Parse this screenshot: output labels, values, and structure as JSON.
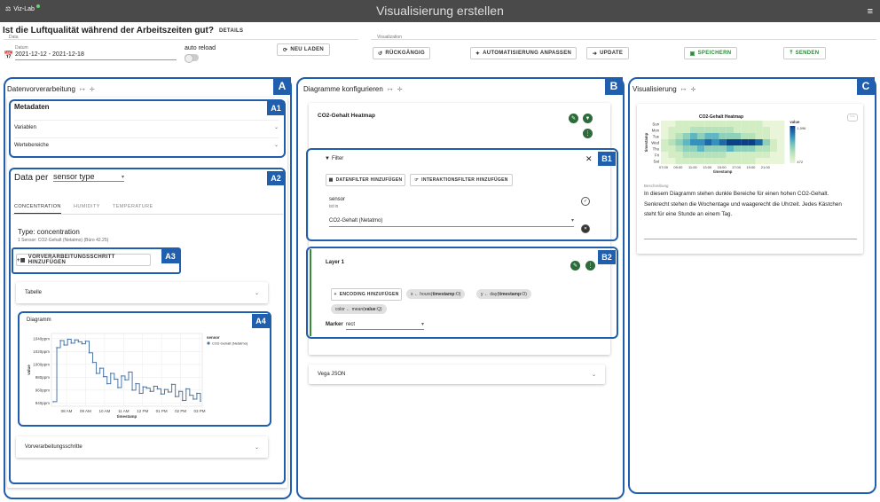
{
  "header": {
    "logo_text": "Viz-Lab",
    "app_title": "Visualisierung erstellen",
    "menu_icon": "≡"
  },
  "question": {
    "text": "Ist die Luftqualität während der Arbeitszeiten gut?",
    "details": "DETAILS"
  },
  "data_group": {
    "label": "Data",
    "date_label": "Datum",
    "date_value": "2021-12-12 - 2021-12-18",
    "auto_reload_label": "auto reload",
    "reload_button": "NEU LADEN"
  },
  "viz_group": {
    "label": "Visualization",
    "undo_button": "RÜCKGÄNGIG",
    "automation_button": "AUTOMATISIERUNG ANPASSEN",
    "update_button": "UPDATE",
    "save_button": "SPEICHERN",
    "send_button": "SENDEN"
  },
  "panel_a": {
    "badge": "A",
    "title": "Datenvorverarbeitung",
    "metadata": {
      "badge": "A1",
      "title": "Metadaten",
      "items": [
        "Variablen",
        "Wertebereiche"
      ]
    },
    "data_per": {
      "badge": "A2",
      "label": "Data per",
      "value": "sensor type"
    },
    "tabs": [
      "CONCENTRATION",
      "HUMIDITY",
      "TEMPERATURE"
    ],
    "type_title": "Type: concentration",
    "type_sub": "1 Sensor: CO2-Gehalt (Netatmo) (Büro 42.25)",
    "add_step": {
      "badge": "A3",
      "label": "VORVERARBEITUNGSSCHRITT HINZUFÜGEN"
    },
    "table_label": "Tabelle",
    "diagram": {
      "badge": "A4",
      "label": "Diagramm"
    },
    "steps_label": "Vorverarbeitungsschritte"
  },
  "panel_b": {
    "badge": "B",
    "title": "Diagramme konfigurieren",
    "chart_card_title": "CO2-Gehalt Heatmap",
    "filter": {
      "badge": "B1",
      "title": "Filter",
      "data_filter_button": "DATENFILTER HINZUFÜGEN",
      "interaction_filter_button": "INTERAKTIONSFILTER HINZUFÜGEN",
      "sensor_label": "sensor",
      "sensor_op": "ist in",
      "sensor_value": "CO2-Gehalt (Netatmo)"
    },
    "layer": {
      "badge": "B2",
      "title": "Layer 1",
      "encoding_button": "ENCODING HINZUFÜGEN",
      "chips": [
        {
          "pre": "x ← hours(",
          "bold": "timestamp",
          "post": ":O)"
        },
        {
          "pre": "y ← day(",
          "bold": "timestamp",
          "post": ":O)"
        },
        {
          "pre": "color ← mean(",
          "bold": "value",
          "post": ":Q)"
        }
      ],
      "marker_label": "Marker",
      "marker_value": "rect"
    },
    "vega_label": "Vega JSON"
  },
  "panel_c": {
    "badge": "C",
    "title": "Visualisierung",
    "heatmap_title": "CO2-Gehalt Heatmap",
    "description_label": "Beschreibung",
    "description": "In diesem Diagramm stehen dunkle Bereiche für einen hohen CO2-Gehalt. Senkrecht stehen die Wochentage und waagerecht die Uhrzeit. Jedes Kästchen steht für eine Stunde an einem Tag."
  },
  "chart_data": [
    {
      "type": "line",
      "xlabel": "timestamp",
      "ylabel": "value",
      "x": [
        "08 AM",
        "09 AM",
        "10 AM",
        "11 AM",
        "12 PM",
        "01 PM",
        "02 PM",
        "03 PM"
      ],
      "y_ticks": [
        "940ppm",
        "960ppm",
        "980ppm",
        "1000ppm",
        "1020ppm",
        "1040ppm"
      ],
      "ylim": [
        935,
        1048
      ],
      "legend_title": "sensor",
      "series": [
        {
          "name": "CO2-Gehalt (Netatmo)",
          "values": [
            942,
            1026,
            1037,
            1030,
            1039,
            1033,
            1038,
            1035,
            1032,
            1036,
            1018,
            1003,
            986,
            994,
            981,
            970,
            986,
            977,
            964,
            982,
            976,
            988,
            960,
            970,
            955,
            965,
            963,
            958,
            966,
            962,
            954,
            961,
            957,
            969,
            950,
            958,
            944,
            962,
            952,
            946,
            955,
            943
          ]
        }
      ],
      "legend_position": "top-right"
    },
    {
      "type": "heatmap",
      "title": "CO2-Gehalt Heatmap",
      "xlabel": "timestamp",
      "ylabel": "timestamp",
      "x": [
        "07:00",
        "09:00",
        "11:00",
        "13:00",
        "15:00",
        "17:00",
        "19:00",
        "21:00"
      ],
      "y": [
        "Sun",
        "Mon",
        "Tue",
        "Wed",
        "Thu",
        "Fri",
        "Sat"
      ],
      "legend_title": "value",
      "legend_range_labels": [
        "1,096",
        "472"
      ]
    }
  ]
}
